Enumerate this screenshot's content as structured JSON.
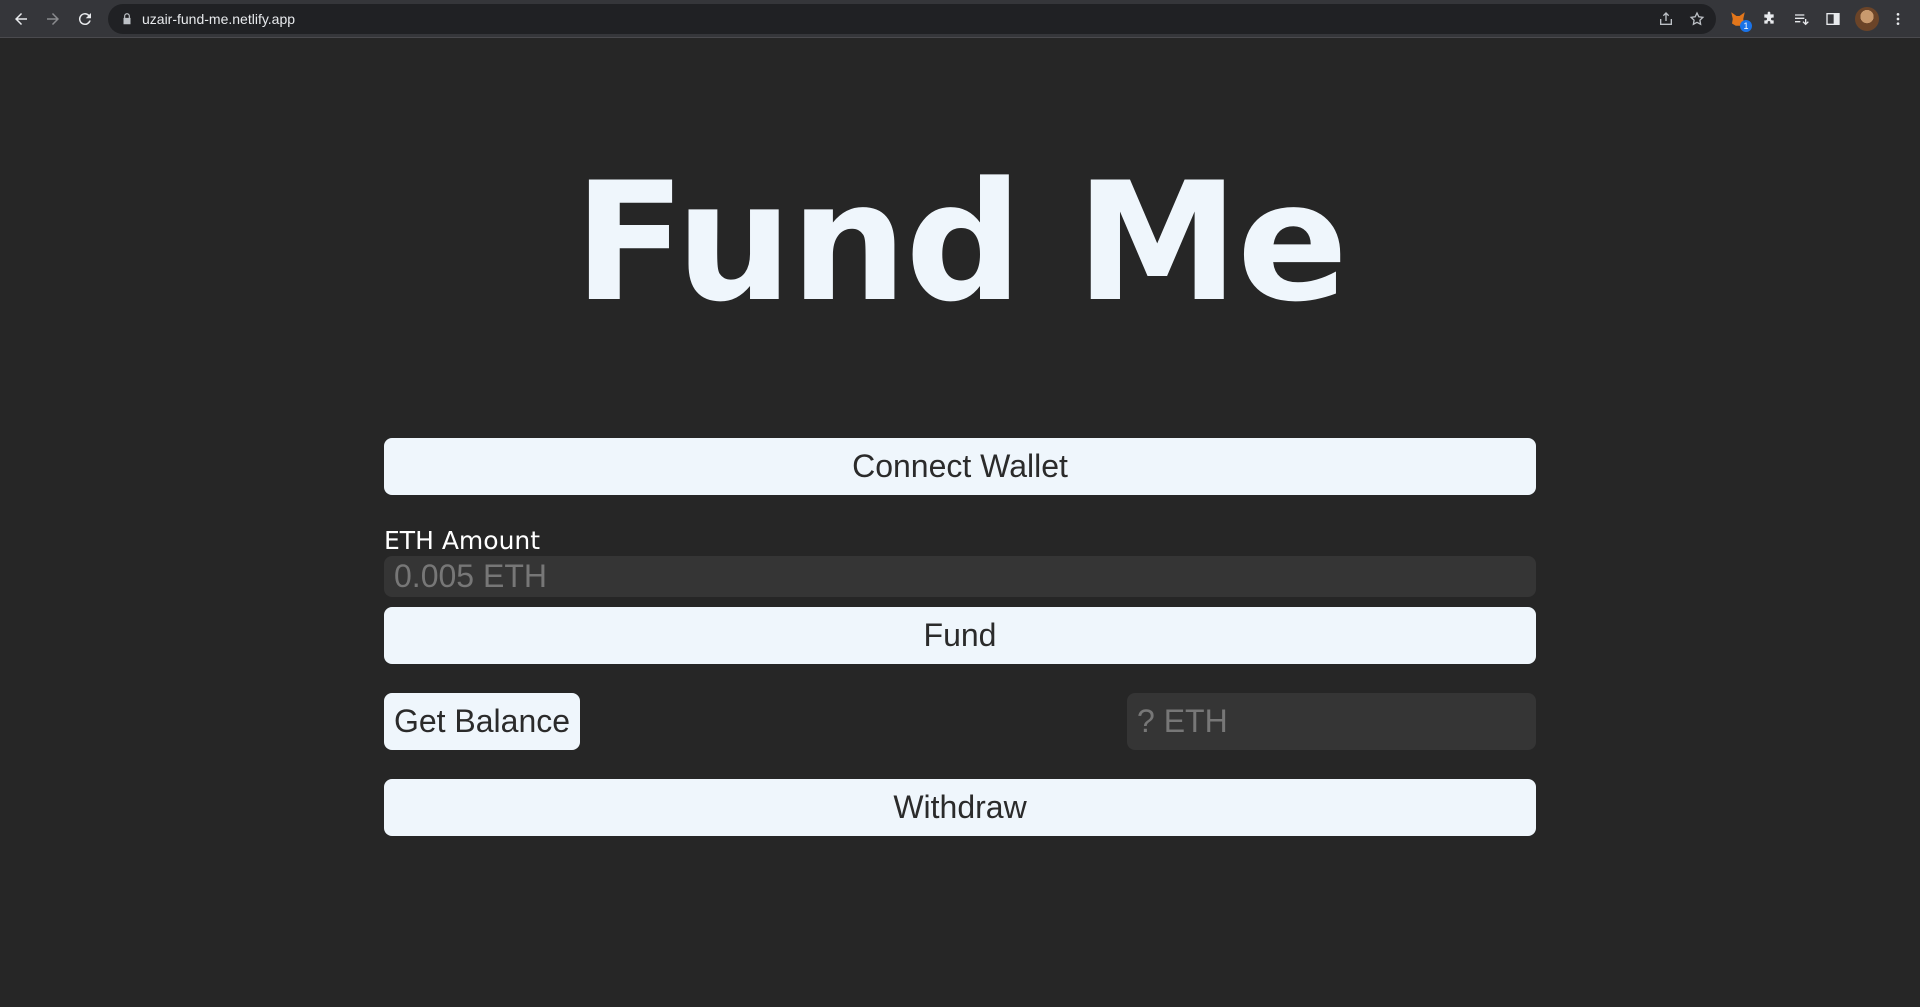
{
  "browser": {
    "url": "uzair-fund-me.netlify.app",
    "extension_badge": "1"
  },
  "page": {
    "title": "Fund Me",
    "connect_button": "Connect Wallet",
    "eth_amount_label": "ETH Amount",
    "eth_amount_placeholder": "0.005 ETH",
    "fund_button": "Fund",
    "get_balance_button": "Get Balance",
    "balance_placeholder": "? ETH",
    "withdraw_button": "Withdraw"
  },
  "colors": {
    "background": "#262626",
    "button_bg": "#eff6fc",
    "input_bg": "#353535"
  }
}
